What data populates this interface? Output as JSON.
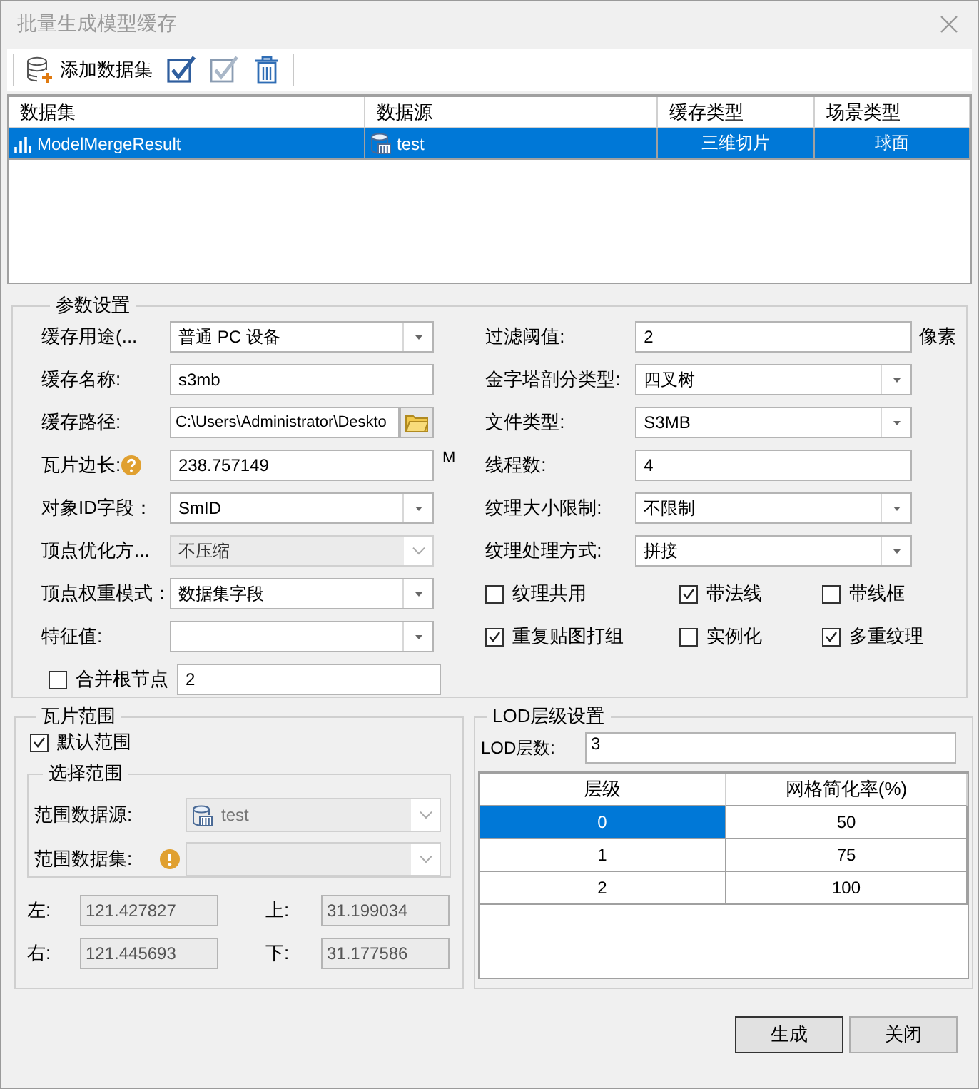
{
  "window": {
    "title": "批量生成模型缓存"
  },
  "toolbar": {
    "add_dataset": "添加数据集"
  },
  "dataset_table": {
    "columns": [
      "数据集",
      "数据源",
      "缓存类型",
      "场景类型"
    ],
    "rows": [
      {
        "dataset": "ModelMergeResult",
        "datasource": "test",
        "cache_type": "三维切片",
        "scene_type": "球面",
        "selected": true
      }
    ]
  },
  "parameters": {
    "title": "参数设置",
    "left": [
      {
        "kind": "combo",
        "label": "缓存用途(...",
        "value": "普通 PC 设备",
        "disabled": false
      },
      {
        "kind": "text",
        "label": "缓存名称:",
        "value": "s3mb"
      },
      {
        "kind": "path",
        "label": "缓存路径:",
        "value": "C:\\Users\\Administrator\\Deskto"
      },
      {
        "kind": "text",
        "label": "瓦片边长:",
        "value": "238.757149",
        "unit": "M",
        "help": true
      },
      {
        "kind": "combo",
        "label": "对象ID字段：",
        "value": "SmID",
        "disabled": false
      },
      {
        "kind": "combo",
        "label": "顶点优化方...",
        "value": "不压缩",
        "disabled": true
      },
      {
        "kind": "combo",
        "label": "顶点权重模式：",
        "value": "数据集字段",
        "disabled": false
      },
      {
        "kind": "combo",
        "label": "特征值:",
        "disabled": false
      },
      {
        "kind": "check_text",
        "label": "合并根节点",
        "checked": false,
        "value": "2"
      }
    ],
    "right": [
      {
        "kind": "text",
        "label": "过滤阈值:",
        "value": "2",
        "unit": "像素"
      },
      {
        "kind": "combo",
        "label": "金字塔剖分类型:",
        "value": "四叉树",
        "disabled": false
      },
      {
        "kind": "combo",
        "label": "文件类型:",
        "value": "S3MB",
        "disabled": false
      },
      {
        "kind": "text",
        "label": "线程数:",
        "value": "4"
      },
      {
        "kind": "combo",
        "label": "纹理大小限制:",
        "value": "不限制",
        "disabled": false
      },
      {
        "kind": "combo",
        "label": "纹理处理方式:",
        "value": "拼接",
        "disabled": false
      }
    ],
    "options": [
      {
        "label": "纹理共用",
        "checked": false
      },
      {
        "label": "带法线",
        "checked": true
      },
      {
        "label": "带线框",
        "checked": false
      },
      {
        "label": "重复贴图打组",
        "checked": true
      },
      {
        "label": "实例化",
        "checked": false
      },
      {
        "label": "多重纹理",
        "checked": true
      }
    ]
  },
  "tile_range": {
    "title": "瓦片范围",
    "default_range": {
      "label": "默认范围",
      "checked": true
    },
    "select_range": {
      "title": "选择范围",
      "fields": [
        {
          "label": "范围数据源:",
          "value": "test",
          "warning": false,
          "disabled": true
        },
        {
          "label": "范围数据集:",
          "warning": true,
          "disabled": true
        }
      ]
    },
    "bounds": [
      {
        "label": "左:",
        "value": "121.427827",
        "disabled": true
      },
      {
        "label": "上:",
        "value": "31.199034",
        "disabled": true
      },
      {
        "label": "右:",
        "value": "121.445693",
        "disabled": true
      },
      {
        "label": "下:",
        "value": "31.177586",
        "disabled": true
      }
    ]
  },
  "lod": {
    "title": "LOD层级设置",
    "count_label": "LOD层数:",
    "count": "3",
    "columns": [
      "层级",
      "网格简化率(%)"
    ],
    "rows": [
      {
        "level": "0",
        "rate": "50",
        "selected": true
      },
      {
        "level": "1",
        "rate": "75",
        "selected": false
      },
      {
        "level": "2",
        "rate": "100",
        "selected": false
      }
    ]
  },
  "buttons": [
    {
      "label": "生成",
      "default": true
    },
    {
      "label": "关闭",
      "default": false
    }
  ]
}
